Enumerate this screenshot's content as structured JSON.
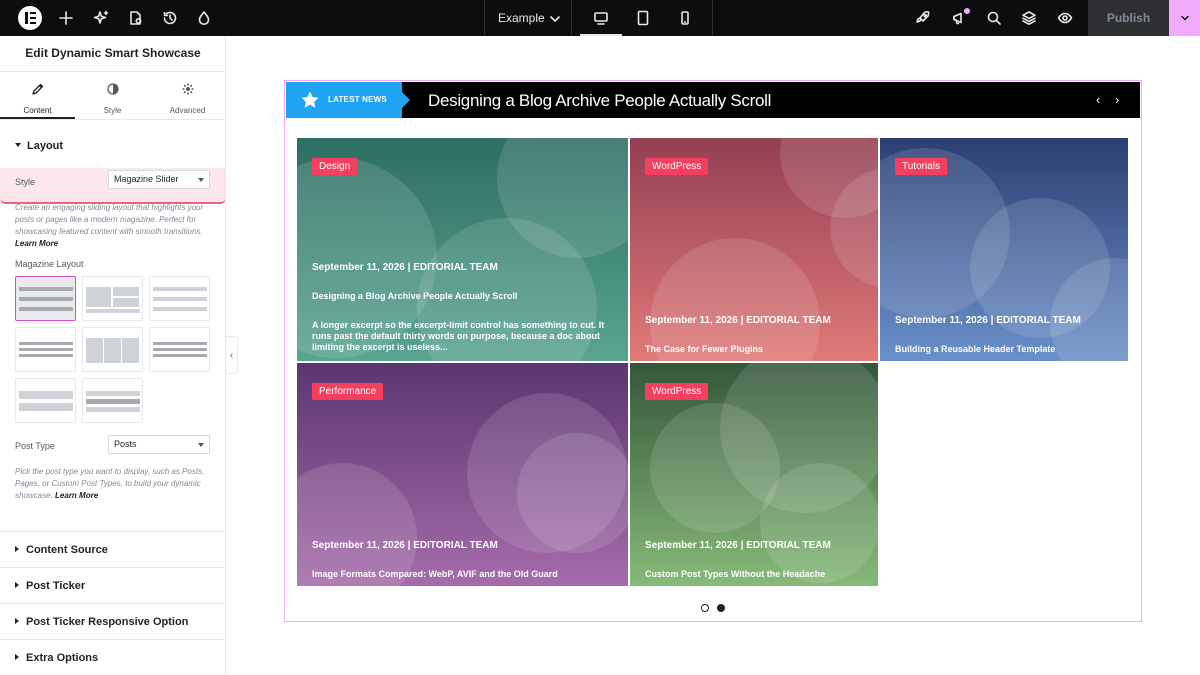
{
  "topbar": {
    "page_name": "Example",
    "publish_label": "Publish",
    "icons": [
      "elementor-logo-icon",
      "add-element-icon",
      "ai-sparkle-icon",
      "site-settings-icon",
      "history-icon",
      "theme-style-icon",
      "desktop-icon",
      "tablet-icon",
      "mobile-icon",
      "rocket-icon",
      "notifications-icon",
      "search-icon",
      "navigator-layers-icon",
      "preview-eye-icon",
      "publish-options-chevron-icon"
    ]
  },
  "panel": {
    "title": "Edit Dynamic Smart Showcase",
    "tabs": [
      {
        "label": "Content",
        "active": true
      },
      {
        "label": "Style",
        "active": false
      },
      {
        "label": "Advanced",
        "active": false
      }
    ],
    "layout_section": "Layout",
    "style_field": {
      "label": "Style",
      "value": "Magazine Slider"
    },
    "style_help": "Create an engaging sliding layout that highlights your posts or pages like a modern magazine. Perfect for showcasing featured content with smooth transitions.",
    "learn_more": "Learn More",
    "magazine_layout_label": "Magazine Layout",
    "magazine_layout_count": 8,
    "magazine_layout_selected": 1,
    "post_type_field": {
      "label": "Post Type",
      "value": "Posts"
    },
    "post_type_help": "Pick the post type you want to display, such as Posts, Pages, or Custom Post Types, to build your dynamic showcase.",
    "accordions": [
      "Content Source",
      "Post Ticker",
      "Post Ticker Responsive Option",
      "Extra Options"
    ]
  },
  "ticker": {
    "badge": "LATEST NEWS",
    "headline": "Designing a Blog Archive People Actually Scroll",
    "prev": "‹",
    "next": "›",
    "badge_color": "#1fa3f2"
  },
  "cards": [
    {
      "category": "Design",
      "meta": "September 11, 2026 | EDITORIAL TEAM",
      "title": "Designing a Blog Archive People Actually Scroll",
      "excerpt": "A longer excerpt so the excerpt-limit control has something to cut. It runs past the default thirty words on purpose, because a doc about limiting the excerpt is useless...",
      "gradient": [
        "#2e6e63",
        "#5aa58f"
      ]
    },
    {
      "category": "WordPress",
      "meta": "September 11, 2026 | EDITORIAL TEAM",
      "title": "The Case for Fewer Plugins",
      "excerpt": "",
      "gradient": [
        "#933f53",
        "#e07a78"
      ]
    },
    {
      "category": "Tutorials",
      "meta": "September 11, 2026 | EDITORIAL TEAM",
      "title": "Building a Reusable Header Template",
      "excerpt": "",
      "gradient": [
        "#2b3f73",
        "#6a90c9"
      ]
    },
    {
      "category": "Performance",
      "meta": "September 11, 2026 | EDITORIAL TEAM",
      "title": "Image Formats Compared: WebP, AVIF and the Old Guard",
      "excerpt": "",
      "gradient": [
        "#5b3670",
        "#a66bab"
      ]
    },
    {
      "category": "WordPress",
      "meta": "September 11, 2026 | EDITORIAL TEAM",
      "title": "Custom Post Types Without the Headache",
      "excerpt": "",
      "gradient": [
        "#34573a",
        "#86ba78"
      ]
    }
  ],
  "slider": {
    "pages": 2,
    "current": 2
  },
  "colors": {
    "category_badge": "#f43f5e",
    "accent_pink": "#f0abfc"
  }
}
